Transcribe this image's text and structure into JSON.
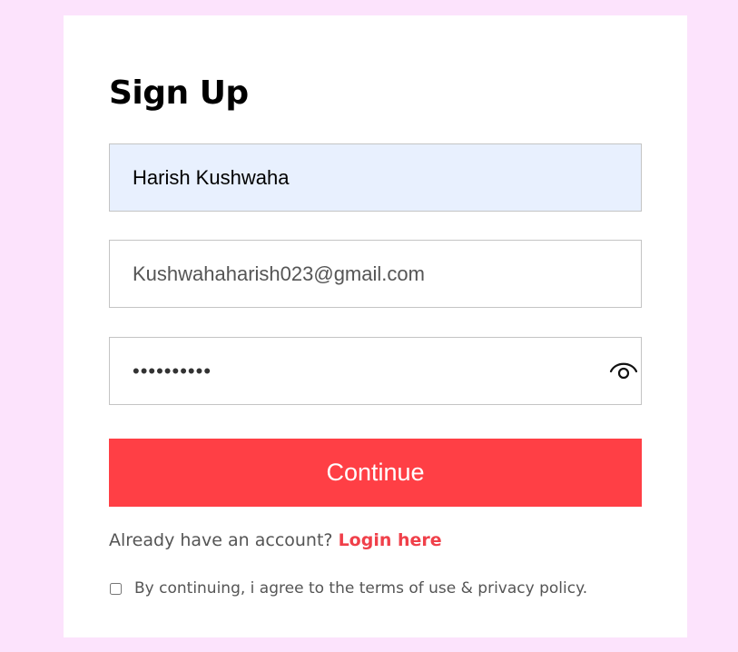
{
  "form": {
    "title": "Sign Up",
    "name_value": "Harish Kushwaha",
    "email_value": "Kushwahaharish023@gmail.com",
    "password_masked": "••••••••••",
    "password_icon": "eye-icon",
    "continue_label": "Continue",
    "account_prompt": "Already have an account?",
    "login_link": "Login here",
    "terms_label": "By continuing, i agree to the terms of use & privacy policy.",
    "terms_checked": false
  },
  "colors": {
    "background": "#fce3fc",
    "card": "#ffffff",
    "autofill": "#e8f0fe",
    "accent": "#ff3f45",
    "link": "#f0404a"
  }
}
